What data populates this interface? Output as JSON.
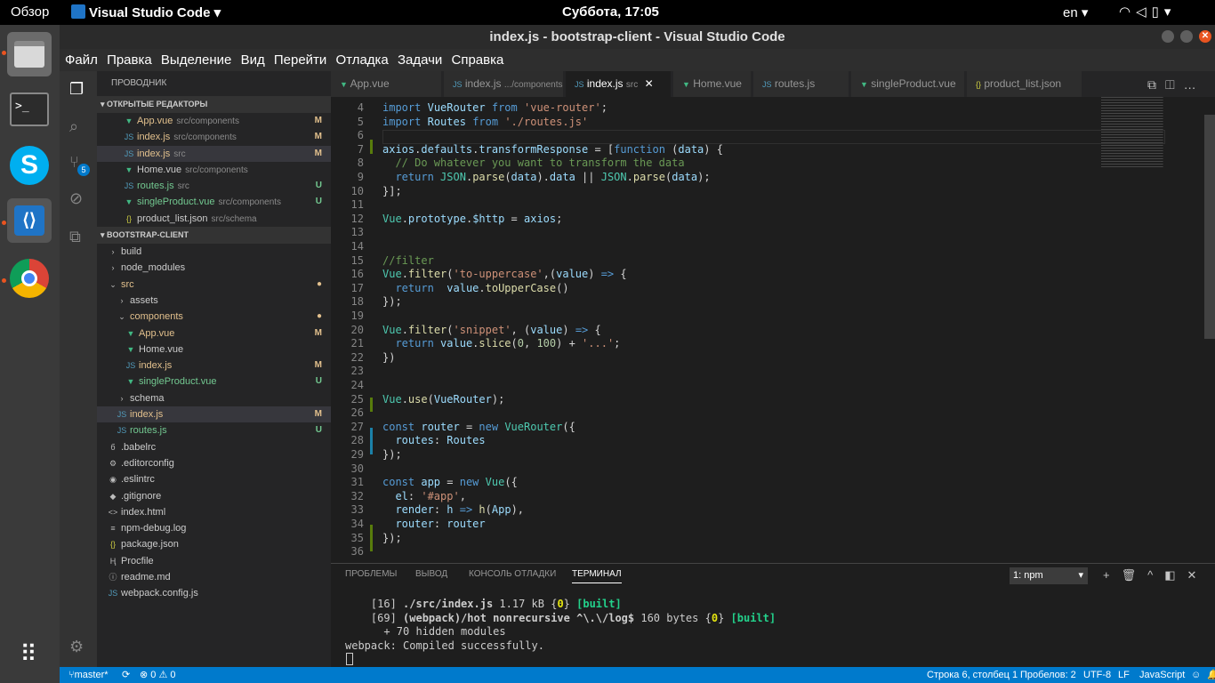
{
  "top": {
    "overview": "Обзор",
    "app": "Visual Studio Code ▾",
    "clock": "Суббота, 17:05",
    "lang": "en ▾"
  },
  "window": {
    "title": "index.js - bootstrap-client - Visual Studio Code"
  },
  "menu": [
    "Файл",
    "Правка",
    "Выделение",
    "Вид",
    "Перейти",
    "Отладка",
    "Задачи",
    "Справка"
  ],
  "sidebar": {
    "title": "ПРОВОДНИК",
    "open_editors": "▾ ОТКРЫТЫЕ РЕДАКТОРЫ",
    "project": "▾ BOOTSTRAP-CLIENT",
    "scm_badge": "5",
    "open": [
      {
        "icon": "▼",
        "name": "App.vue",
        "path": "src/components",
        "st": "M"
      },
      {
        "icon": "JS",
        "name": "index.js",
        "path": "src/components",
        "st": "M"
      },
      {
        "icon": "JS",
        "name": "index.js",
        "path": "src",
        "st": "M"
      },
      {
        "icon": "▼",
        "name": "Home.vue",
        "path": "src/components",
        "st": ""
      },
      {
        "icon": "JS",
        "name": "routes.js",
        "path": "src",
        "st": "U"
      },
      {
        "icon": "▼",
        "name": "singleProduct.vue",
        "path": "src/components",
        "st": "U"
      },
      {
        "icon": "{}",
        "name": "product_list.json",
        "path": "src/schema",
        "st": ""
      }
    ],
    "tree": [
      {
        "icon": "›",
        "name": "build",
        "ind": 1,
        "st": ""
      },
      {
        "icon": "›",
        "name": "node_modules",
        "ind": 1,
        "st": ""
      },
      {
        "icon": "⌄",
        "name": "src",
        "ind": 1,
        "st": "●"
      },
      {
        "icon": "›",
        "name": "assets",
        "ind": 2,
        "st": ""
      },
      {
        "icon": "⌄",
        "name": "components",
        "ind": 2,
        "st": "●"
      },
      {
        "icon": "▼",
        "name": "App.vue",
        "ind": 3,
        "st": "M"
      },
      {
        "icon": "▼",
        "name": "Home.vue",
        "ind": 3,
        "st": ""
      },
      {
        "icon": "JS",
        "name": "index.js",
        "ind": 3,
        "st": "M"
      },
      {
        "icon": "▼",
        "name": "singleProduct.vue",
        "ind": 3,
        "st": "U"
      },
      {
        "icon": "›",
        "name": "schema",
        "ind": 2,
        "st": ""
      },
      {
        "icon": "JS",
        "name": "index.js",
        "ind": 2,
        "st": "M"
      },
      {
        "icon": "JS",
        "name": "routes.js",
        "ind": 2,
        "st": "U"
      },
      {
        "icon": "б",
        "name": ".babelrc",
        "ind": 1,
        "st": ""
      },
      {
        "icon": "⚙",
        "name": ".editorconfig",
        "ind": 1,
        "st": ""
      },
      {
        "icon": "◉",
        "name": ".eslintrc",
        "ind": 1,
        "st": ""
      },
      {
        "icon": "◆",
        "name": ".gitignore",
        "ind": 1,
        "st": ""
      },
      {
        "icon": "<>",
        "name": "index.html",
        "ind": 1,
        "st": ""
      },
      {
        "icon": "≡",
        "name": "npm-debug.log",
        "ind": 1,
        "st": ""
      },
      {
        "icon": "{}",
        "name": "package.json",
        "ind": 1,
        "st": ""
      },
      {
        "icon": "Ⱨ",
        "name": "Procfile",
        "ind": 1,
        "st": ""
      },
      {
        "icon": "ⓘ",
        "name": "readme.md",
        "ind": 1,
        "st": ""
      },
      {
        "icon": "JS",
        "name": "webpack.config.js",
        "ind": 1,
        "st": ""
      }
    ]
  },
  "tabs": [
    {
      "icon": "▼",
      "name": "App.vue",
      "path": ""
    },
    {
      "icon": "JS",
      "name": "index.js",
      "path": ".../components"
    },
    {
      "icon": "JS",
      "name": "index.js",
      "path": "src",
      "active": true
    },
    {
      "icon": "▼",
      "name": "Home.vue",
      "path": ""
    },
    {
      "icon": "JS",
      "name": "routes.js",
      "path": ""
    },
    {
      "icon": "▼",
      "name": "singleProduct.vue",
      "path": ""
    },
    {
      "icon": "{}",
      "name": "product_list.json",
      "path": ""
    }
  ],
  "code": [
    {
      "n": "4",
      "h": "<span class='k'>import</span> <span class='v'>VueRouter</span> <span class='k'>from</span> <span class='s'>'vue-router'</span>;"
    },
    {
      "n": "5",
      "h": "<span class='k'>import</span> <span class='v'>Routes</span> <span class='k'>from</span> <span class='s'>'./routes.js'</span>"
    },
    {
      "n": "6",
      "h": ""
    },
    {
      "n": "7",
      "h": "<span class='v'>axios</span>.<span class='v'>defaults</span>.<span class='v'>transformResponse</span> = [<span class='k'>function</span> (<span class='v'>data</span>) {"
    },
    {
      "n": "8",
      "h": "  <span class='c'>// Do whatever you want to transform the data</span>"
    },
    {
      "n": "9",
      "h": "  <span class='k'>return</span> <span class='t'>JSON</span>.<span class='f'>parse</span>(<span class='v'>data</span>).<span class='v'>data</span> || <span class='t'>JSON</span>.<span class='f'>parse</span>(<span class='v'>data</span>);"
    },
    {
      "n": "10",
      "h": "}];"
    },
    {
      "n": "11",
      "h": ""
    },
    {
      "n": "12",
      "h": "<span class='t'>Vue</span>.<span class='v'>prototype</span>.<span class='v'>$http</span> = <span class='v'>axios</span>;"
    },
    {
      "n": "13",
      "h": ""
    },
    {
      "n": "14",
      "h": ""
    },
    {
      "n": "15",
      "h": "<span class='c'>//filter</span>"
    },
    {
      "n": "16",
      "h": "<span class='t'>Vue</span>.<span class='f'>filter</span>(<span class='s'>'to-uppercase'</span>,(<span class='v'>value</span>) <span class='k'>=&gt;</span> {"
    },
    {
      "n": "17",
      "h": "  <span class='k'>return</span>  <span class='v'>value</span>.<span class='f'>toUpperCase</span>()"
    },
    {
      "n": "18",
      "h": "});"
    },
    {
      "n": "19",
      "h": ""
    },
    {
      "n": "20",
      "h": "<span class='t'>Vue</span>.<span class='f'>filter</span>(<span class='s'>'snippet'</span>, (<span class='v'>value</span>) <span class='k'>=&gt;</span> {"
    },
    {
      "n": "21",
      "h": "  <span class='k'>return</span> <span class='v'>value</span>.<span class='f'>slice</span>(<span class='n'>0</span>, <span class='n'>100</span>) + <span class='s'>'...'</span>;"
    },
    {
      "n": "22",
      "h": "})"
    },
    {
      "n": "23",
      "h": ""
    },
    {
      "n": "24",
      "h": ""
    },
    {
      "n": "25",
      "h": "<span class='t'>Vue</span>.<span class='f'>use</span>(<span class='v'>VueRouter</span>);"
    },
    {
      "n": "26",
      "h": ""
    },
    {
      "n": "27",
      "h": "<span class='k'>const</span> <span class='v'>router</span> = <span class='k'>new</span> <span class='t'>VueRouter</span>({"
    },
    {
      "n": "28",
      "h": "  <span class='v'>routes</span>: <span class='v'>Routes</span>"
    },
    {
      "n": "29",
      "h": "});"
    },
    {
      "n": "30",
      "h": ""
    },
    {
      "n": "31",
      "h": "<span class='k'>const</span> <span class='v'>app</span> = <span class='k'>new</span> <span class='t'>Vue</span>({"
    },
    {
      "n": "32",
      "h": "  <span class='v'>el</span>: <span class='s'>'#app'</span>,"
    },
    {
      "n": "33",
      "h": "  <span class='v'>render</span>: <span class='v'>h</span> <span class='k'>=&gt;</span> <span class='f'>h</span>(<span class='v'>App</span>),"
    },
    {
      "n": "34",
      "h": "  <span class='v'>router</span>: <span class='v'>router</span>"
    },
    {
      "n": "35",
      "h": "});"
    },
    {
      "n": "36",
      "h": ""
    }
  ],
  "panel": {
    "tabs": [
      "ПРОБЛЕМЫ",
      "ВЫВОД",
      "КОНСОЛЬ ОТЛАДКИ",
      "ТЕРМИНАЛ"
    ],
    "select": "1: npm",
    "lines": [
      "    [16] <b>./src/index.js</b> 1.17 kB {<b style='color:#e5e510'>0</b>} <b style='color:#23d18b'>[built]</b>",
      "    [69] <b>(webpack)/hot nonrecursive ^\\.\\/log$</b> 160 bytes {<b style='color:#e5e510'>0</b>} <b style='color:#23d18b'>[built]</b>",
      "      + 70 hidden modules",
      "webpack: Compiled successfully."
    ]
  },
  "status": {
    "branch": "master*",
    "errors": "⊗ 0 ⚠ 0",
    "pos": "Строка 6, столбец 1",
    "spaces": "Пробелов: 2",
    "enc": "UTF-8",
    "eol": "LF",
    "lang": "JavaScript"
  }
}
